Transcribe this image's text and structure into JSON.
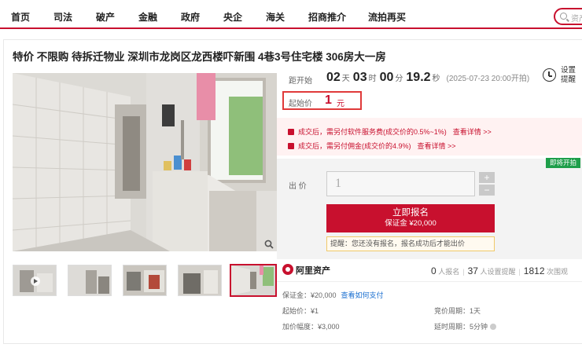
{
  "nav": {
    "items": [
      "首页",
      "司法",
      "破产",
      "金融",
      "政府",
      "央企",
      "海关",
      "招商推介",
      "流拍再买"
    ],
    "search_placeholder": "资产"
  },
  "listing": {
    "title": "特价 不限购 待拆迁物业 深圳市龙岗区龙西楼吓新围 4巷3号住宅楼 306房大一房"
  },
  "countdown": {
    "label": "距开始",
    "days": "02",
    "days_unit": "天",
    "hours": "03",
    "hours_unit": "时",
    "minutes": "00",
    "minutes_unit": "分",
    "seconds": "19.2",
    "seconds_unit": "秒",
    "start_time": "(2025-07-23 20:00开拍)"
  },
  "reminder": {
    "label": "设置提醒"
  },
  "price": {
    "label": "起始价",
    "value": "1",
    "unit": "元"
  },
  "notices": [
    {
      "text": "成交后，需另付软件服务费(成交价的0.5%~1%)",
      "more": "查看详情 >>"
    },
    {
      "text": "成交后，需另付佣金(成交价的4.9%)",
      "more": "查看详情 >>"
    }
  ],
  "bid": {
    "badge": "即将开拍",
    "label": "出 价",
    "value": "1",
    "plus": "+",
    "minus": "−",
    "signup_label": "立即报名",
    "deposit_label": "保证金 ¥20,000",
    "tip": "提醒：您还没有报名，报名成功后才能出价"
  },
  "platform": {
    "name": "阿里资产",
    "applicants": "0",
    "applicants_label": "人报名",
    "reminders": "37",
    "reminders_label": "人设置提醒",
    "views": "1812",
    "views_label": "次围观"
  },
  "details": {
    "deposit": "保证金：¥20,000",
    "how_to_pay": "查看如何支付",
    "start_price": "起始价：¥1",
    "bid_cycle": "竞价周期：1天",
    "increment": "加价幅度：¥3,000",
    "delay_cycle": "延时周期：5分钟"
  },
  "colors": {
    "brand_red": "#c8102e",
    "badge_green": "#1e9e4a",
    "link_blue": "#1a6fd0"
  },
  "icons": [
    "search-icon",
    "clock-icon",
    "gift-icon",
    "zoom-icon",
    "brand-logo-icon",
    "help-icon"
  ]
}
